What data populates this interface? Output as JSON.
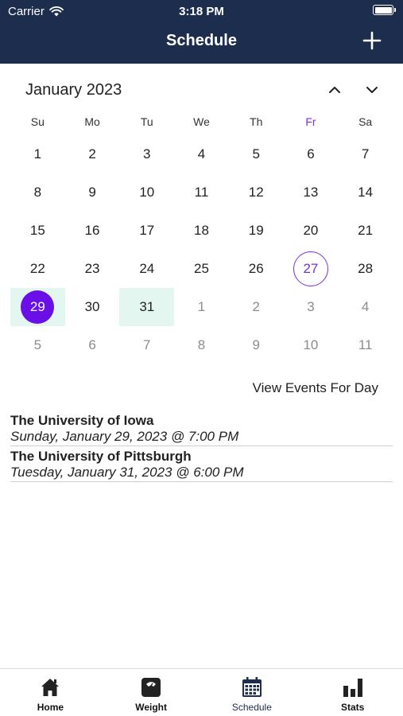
{
  "status_bar": {
    "carrier": "Carrier",
    "time": "3:18 PM"
  },
  "header": {
    "title": "Schedule"
  },
  "calendar": {
    "month_label": "January 2023",
    "weekdays": [
      "Su",
      "Mo",
      "Tu",
      "We",
      "Th",
      "Fr",
      "Sa"
    ],
    "days": [
      "1",
      "2",
      "3",
      "4",
      "5",
      "6",
      "7",
      "8",
      "9",
      "10",
      "11",
      "12",
      "13",
      "14",
      "15",
      "16",
      "17",
      "18",
      "19",
      "20",
      "21",
      "22",
      "23",
      "24",
      "25",
      "26",
      "27",
      "28",
      "29",
      "30",
      "31",
      "1",
      "2",
      "3",
      "4",
      "5",
      "6",
      "7",
      "8",
      "9",
      "10",
      "11"
    ]
  },
  "view_events_label": "View Events For Day",
  "events": [
    {
      "title": "The University of Iowa",
      "date": "Sunday, January 29, 2023 @ 7:00 PM"
    },
    {
      "title": "The University of Pittsburgh",
      "date": "Tuesday, January 31, 2023 @ 6:00 PM"
    }
  ],
  "tabs": [
    {
      "label": "Home",
      "icon": "home-icon"
    },
    {
      "label": "Weight",
      "icon": "scale-icon"
    },
    {
      "label": "Schedule",
      "icon": "calendar-icon"
    },
    {
      "label": "Stats",
      "icon": "bar-chart-icon"
    }
  ],
  "colors": {
    "header_bg": "#1d2d4d",
    "accent_purple": "#6a0fe8",
    "event_highlight": "#e3f7f0"
  }
}
